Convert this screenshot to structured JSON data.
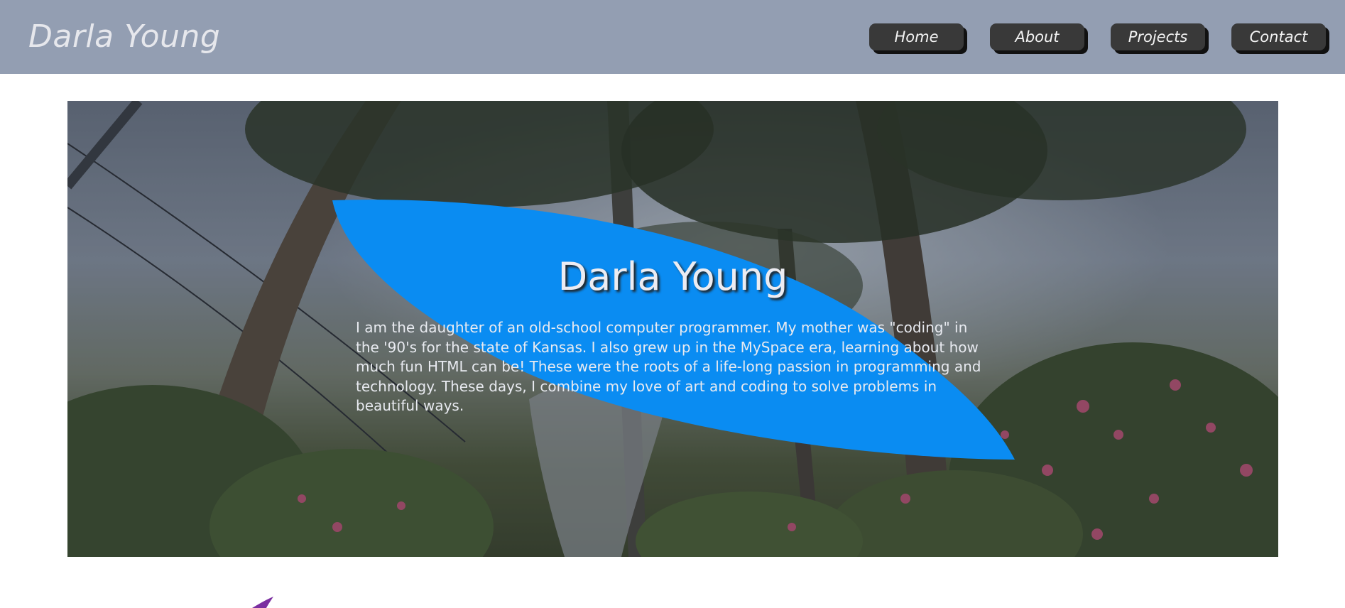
{
  "header": {
    "brand": "Darla Young",
    "nav": [
      {
        "label": "Home"
      },
      {
        "label": "About"
      },
      {
        "label": "Projects"
      },
      {
        "label": "Contact"
      }
    ]
  },
  "hero": {
    "title": "Darla Young",
    "paragraph": "I am the daughter of an old-school computer programmer. My mother was \"coding\" in the '90's for the state of Kansas. I also grew up in the MySpace era, learning about how much fun HTML can be! These were the roots of a life-long passion in programming and technology. These days, I combine my love of art and coding to solve problems in beautiful ways."
  },
  "colors": {
    "header_bg": "#939eb2",
    "nav_button_bg": "#393939",
    "blob": "#0a8cf2",
    "accent": "#7b2fa0"
  }
}
